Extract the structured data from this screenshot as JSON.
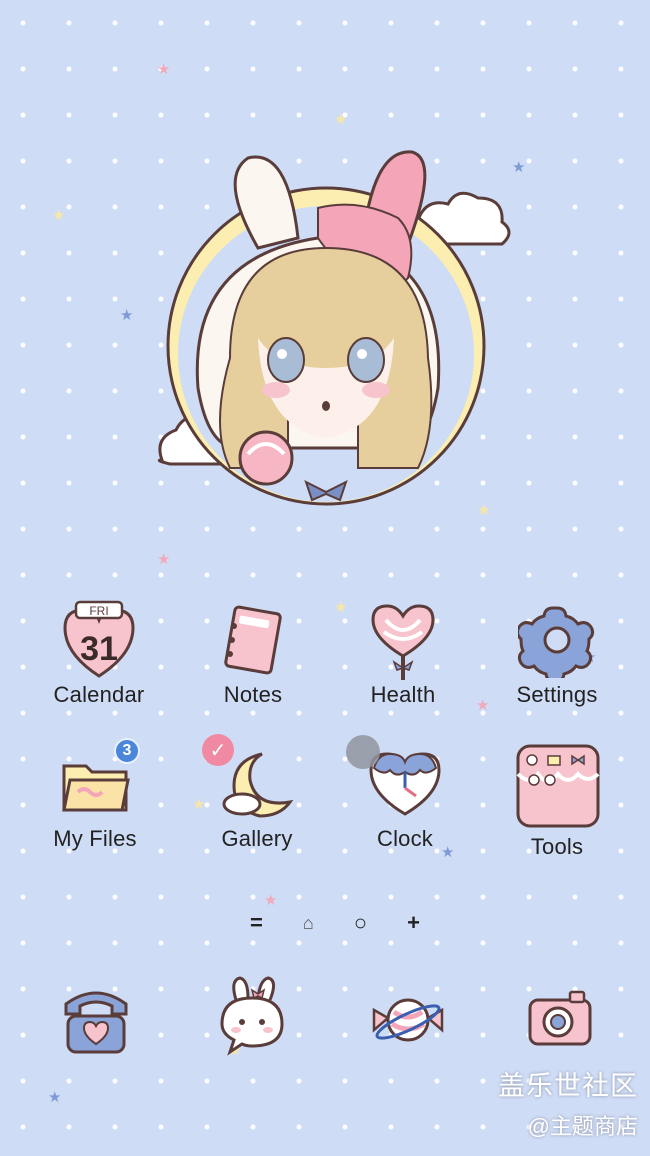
{
  "apps_row1": [
    {
      "label": "Calendar",
      "icon": "calendar-icon",
      "date_day": "FRI",
      "date_num": "31"
    },
    {
      "label": "Notes",
      "icon": "notes-icon"
    },
    {
      "label": "Health",
      "icon": "lollipop-icon"
    },
    {
      "label": "Settings",
      "icon": "gear-icon"
    }
  ],
  "apps_row2": [
    {
      "label": "My Files",
      "icon": "folder-icon",
      "badge": "3"
    },
    {
      "label": "Gallery",
      "icon": "moon-icon",
      "badge": "✓"
    },
    {
      "label": "Clock",
      "icon": "heart-clock-icon"
    },
    {
      "label": "Tools",
      "icon": "tools-folder-icon"
    }
  ],
  "page_indicator": {
    "menu": "=",
    "home": "⌂",
    "current": "○",
    "add": "+"
  },
  "dock": [
    {
      "icon": "phone-icon"
    },
    {
      "icon": "messages-bunny-icon"
    },
    {
      "icon": "candy-planet-icon"
    },
    {
      "icon": "camera-icon"
    }
  ],
  "watermark": {
    "line1": "盖乐世社区",
    "line2": "@主题商店"
  },
  "colors": {
    "background": "#cfdcf6",
    "pink": "#f4a6b8",
    "outline": "#5a3d3a",
    "blue": "#8aa3d8",
    "yellow": "#fbeeb0"
  }
}
